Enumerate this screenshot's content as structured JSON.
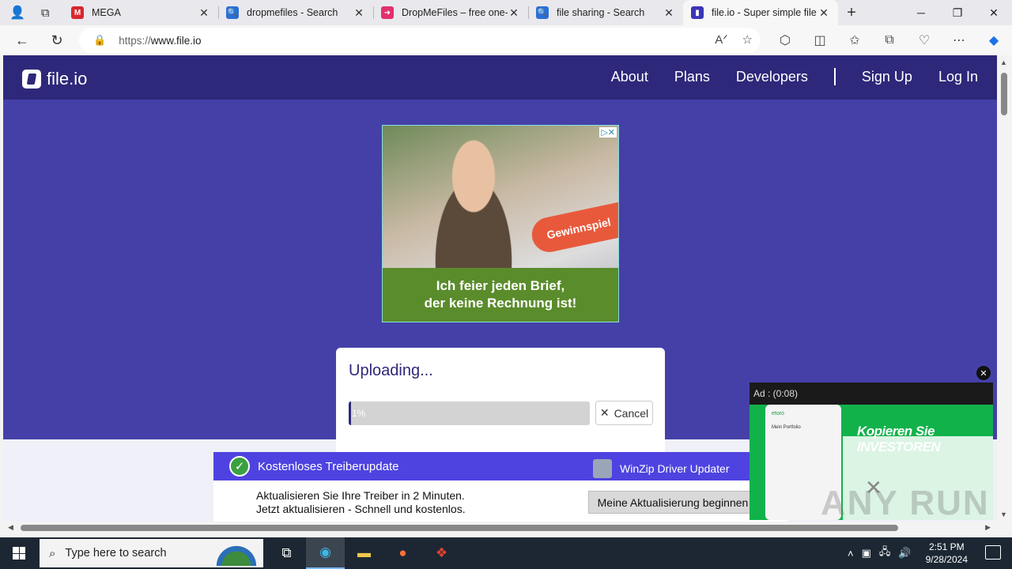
{
  "browser": {
    "tabs": [
      {
        "title": "MEGA",
        "color": "#d9272e",
        "glyph": "M"
      },
      {
        "title": "dropmefiles - Search",
        "color": "#2b6fd6",
        "glyph": "🔍"
      },
      {
        "title": "DropMeFiles – free one-c",
        "color": "#e1306c",
        "glyph": "➜"
      },
      {
        "title": "file sharing - Search",
        "color": "#2b6fd6",
        "glyph": "🔍"
      },
      {
        "title": "file.io - Super simple file",
        "color": "#3b35b8",
        "glyph": "▮"
      }
    ],
    "active_tab_index": 4,
    "url_proto": "https://",
    "url_host": "www.file.io"
  },
  "site": {
    "logo_text": "file.io",
    "nav": {
      "about": "About",
      "plans": "Plans",
      "developers": "Developers",
      "signup": "Sign Up",
      "login": "Log In"
    }
  },
  "ad_top": {
    "badge": "Gewinnspiel",
    "line1": "Ich feier jeden Brief,",
    "line2": "der keine Rechnung ist!"
  },
  "upload": {
    "heading": "Uploading...",
    "progress_label": "1%",
    "progress_fraction": 0.01,
    "cancel_label": "Cancel"
  },
  "ad_banner": {
    "title": "Kostenloses Treiberupdate",
    "brand": "WinZip Driver Updater",
    "body_line1": "Aktualisieren Sie Ihre Treiber in 2 Minuten.",
    "body_line2": "Jetzt aktualisieren - Schnell und kostenlos.",
    "cta": "Meine Aktualisierung beginnen"
  },
  "video_ad": {
    "timer": "Ad : (0:08)",
    "headline": "Kopieren Sie INVESTOREN",
    "phone_brand": "etoro",
    "phone_text": "Mein Portfolio"
  },
  "watermark": "ANY RUN",
  "taskbar": {
    "search_placeholder": "Type here to search",
    "time": "2:51 PM",
    "date": "9/28/2024"
  }
}
